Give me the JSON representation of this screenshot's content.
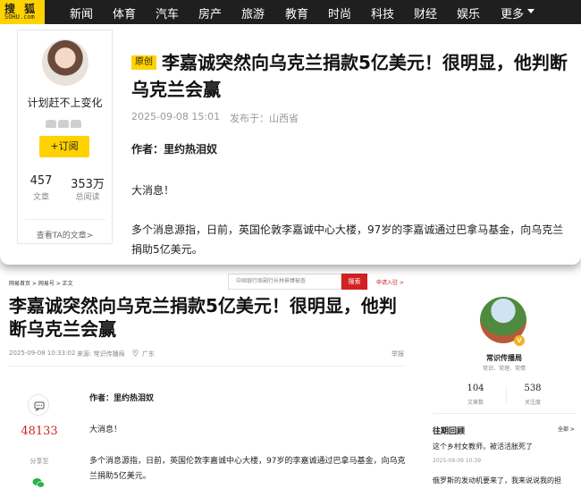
{
  "sohu": {
    "logo": {
      "text": "搜 狐",
      "sub": "SOHU.com"
    },
    "nav": [
      "新闻",
      "体育",
      "汽车",
      "房产",
      "旅游",
      "教育",
      "时尚",
      "科技",
      "财经",
      "娱乐",
      "更多"
    ],
    "author": {
      "name": "计划赶不上变化",
      "follow_label": "+订阅",
      "articles_count": "457",
      "articles_label": "文章",
      "reads_count": "353万",
      "reads_label": "总阅读",
      "view_all": "查看TA的文章>"
    },
    "article": {
      "tag": "原创",
      "title": "李嘉诚突然向乌克兰捐款5亿美元！很明显，他判断乌克兰会赢",
      "date": "2025-09-08 15:01",
      "location": "发布于：山西省",
      "author_line": "作者：里约热泪奴",
      "p1": "大消息！",
      "p2": "多个消息源指，日前，英国伦敦李嘉诚中心大楼，97岁的李嘉诚通过巴拿马基金，向乌克兰捐助5亿美元。"
    }
  },
  "netease": {
    "breadcrumb": "网易首页 > 网易号 > 正文",
    "search_placeholder": "中国银行原副行长林景臻被查",
    "search_button": "搜索",
    "signin": "申请入驻 >",
    "article": {
      "title": "李嘉诚突然向乌克兰捐款5亿美元！很明显，他判断乌克兰会赢",
      "date": "2025-09-08 10:33:02",
      "source": "来源: 常识传播局",
      "location": "广东",
      "report": "举报",
      "comment_count": "48133",
      "share_label": "分享至",
      "author_line": "作者：里约热泪奴",
      "p1": "大消息！",
      "p2": "多个消息源指，日前，英国伦敦李嘉诚中心大楼，97岁的李嘉诚通过巴拿马基金，向乌克兰捐助5亿美元。"
    },
    "account": {
      "name": "常识传播局",
      "desc": "常识、常理、常情",
      "verified": "V",
      "articles_count": "104",
      "articles_label": "文章数",
      "followers_count": "538",
      "followers_label": "关注度"
    },
    "past": {
      "heading": "往期回顾",
      "all": "全部 >",
      "items": [
        {
          "title": "这个乡村女教师，被活活胀死了",
          "date": "2025-09-09 10:39"
        },
        {
          "title": "俄罗斯的发动机要来了，我来说说我的担",
          "date": ""
        }
      ]
    }
  }
}
